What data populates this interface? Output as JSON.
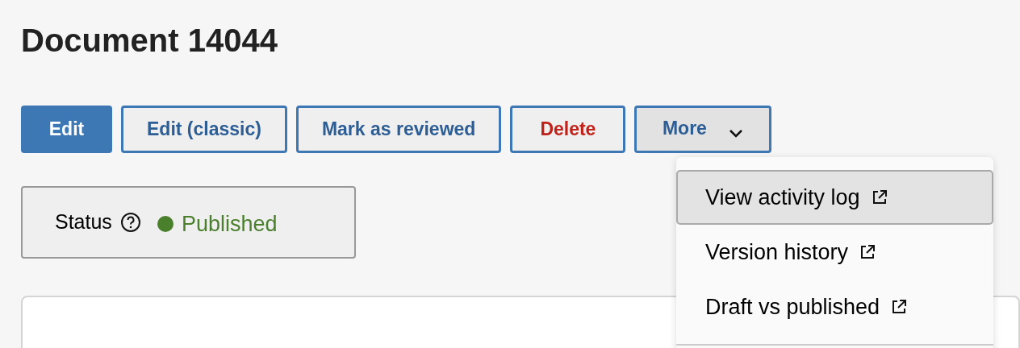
{
  "title": "Document 14044",
  "actions": [
    {
      "label": "Edit",
      "kind": "primary"
    },
    {
      "label": "Edit (classic)",
      "kind": "secondary"
    },
    {
      "label": "Mark as reviewed",
      "kind": "secondary"
    },
    {
      "label": "Delete",
      "kind": "danger"
    },
    {
      "label": "More",
      "kind": "menu",
      "expanded": true
    }
  ],
  "status": {
    "label": "Status",
    "value": "Published",
    "color": "#4a7f2c"
  },
  "menu": [
    {
      "label": "View activity log",
      "selected": true
    },
    {
      "label": "Version history",
      "selected": false
    },
    {
      "label": "Draft vs published",
      "selected": false
    }
  ]
}
